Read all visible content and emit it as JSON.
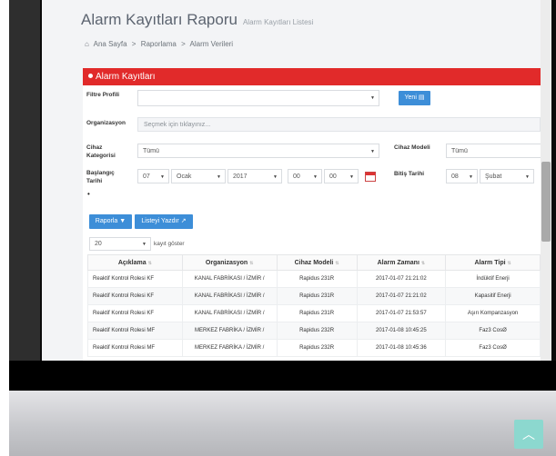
{
  "header": {
    "title": "Alarm Kayıtları Raporu",
    "subtitle": "Alarm Kayıtları Listesi",
    "breadcrumb": [
      "Ana Sayfa",
      ">",
      "Raporlama",
      ">",
      "Alarm Verileri"
    ]
  },
  "panel": {
    "title": "Alarm Kayıtları"
  },
  "form": {
    "filter_profile_label": "Filtre Profili",
    "filter_profile_value": "",
    "new_button": "Yeni",
    "organization_label": "Organizasyon",
    "organization_placeholder": "Seçmek için tıklayınız...",
    "device_category_label": "Cihaz Kategorisi",
    "device_category_value": "Tümü",
    "device_model_label": "Cihaz Modeli",
    "device_model_value": "Tümü",
    "start_date_label": "Başlangıç Tarihi",
    "start_day": "07",
    "start_month": "Ocak",
    "start_year": "2017",
    "start_hour": "00",
    "start_minute": "00",
    "end_date_label": "Bitiş Tarihi",
    "end_day": "08",
    "end_month": "Şubat",
    "bullet": "•"
  },
  "actions": {
    "report_button": "Raporla",
    "print_button": "Listeyi Yazdır"
  },
  "pagination": {
    "page_size": "20",
    "page_size_label": "kayıt göster"
  },
  "table": {
    "columns": [
      "Açıklama",
      "Organizasyon",
      "Cihaz Modeli",
      "Alarm Zamanı",
      "Alarm Tipi"
    ],
    "rows": [
      [
        "Reaktif Kontrol Rolesi KF",
        "KANAL FABRİKASI / İZMİR /",
        "Rapidus 231R",
        "2017-01-07 21:21:02",
        "İndüktif Enerji"
      ],
      [
        "Reaktif Kontrol Rolesi KF",
        "KANAL FABRİKASI / İZMİR /",
        "Rapidus 231R",
        "2017-01-07 21:21:02",
        "Kapasitif Enerji"
      ],
      [
        "Reaktif Kontrol Rolesi KF",
        "KANAL FABRİKASI / İZMİR /",
        "Rapidus 231R",
        "2017-01-07 21:53:57",
        "Aşırı Kompanzasyon"
      ],
      [
        "Reaktif Kontrol Rolesi MF",
        "MERKEZ FABRİKA / İZMİR /",
        "Rapidus 232R",
        "2017-01-08 10:45:25",
        "Faz3 CosØ"
      ],
      [
        "Reaktif Kontrol Rolesi MF",
        "MERKEZ FABRİKA / İZMİR /",
        "Rapidus 232R",
        "2017-01-08 10:45:36",
        "Faz3 CosØ"
      ]
    ]
  },
  "colors": {
    "panel_header": "#e12a2a",
    "button": "#3d8ed8",
    "scroll_top": "#8cd8cf"
  }
}
